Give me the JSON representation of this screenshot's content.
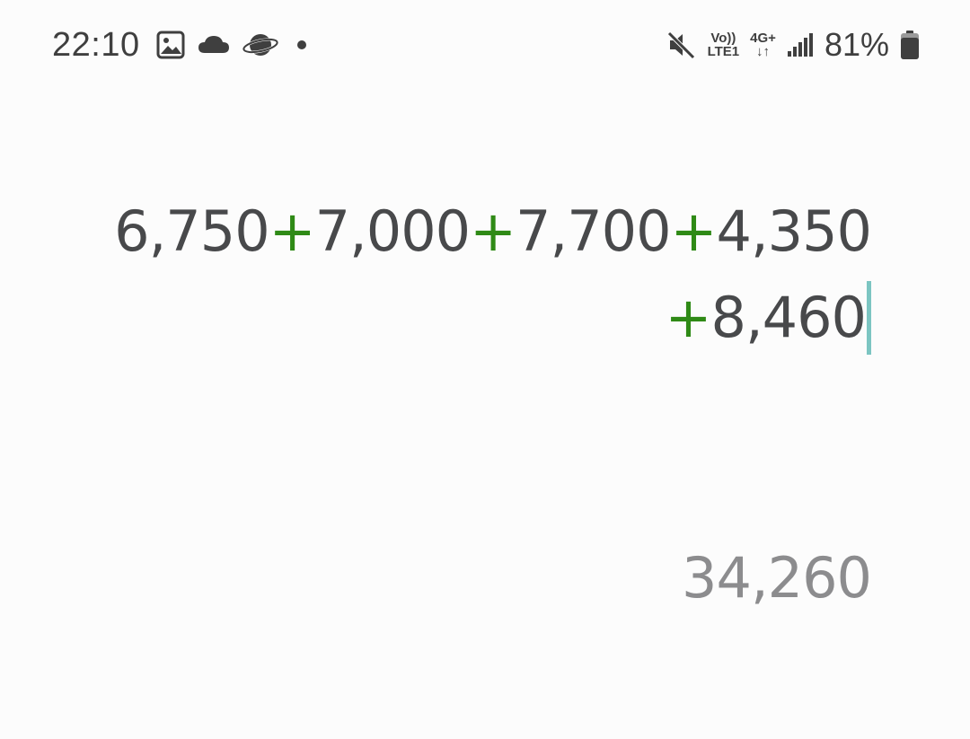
{
  "status_bar": {
    "time": "22:10",
    "left_icons": [
      "image-icon",
      "cloud-icon",
      "browser-planet-icon",
      "dot-icon"
    ],
    "volte_top": "Vo))",
    "volte_bottom": "LTE1",
    "network_type": "4G+",
    "data_arrows": "↓↑",
    "battery_percent": "81%",
    "right_icons": [
      "mute-icon",
      "signal-icon",
      "battery-icon"
    ]
  },
  "calculator": {
    "expression_line1": [
      {
        "text": "6,750",
        "kind": "num"
      },
      {
        "text": "+",
        "kind": "op"
      },
      {
        "text": "7,000",
        "kind": "num"
      },
      {
        "text": "+",
        "kind": "op"
      },
      {
        "text": "7,700",
        "kind": "num"
      },
      {
        "text": "+",
        "kind": "op"
      },
      {
        "text": "4,350",
        "kind": "num"
      }
    ],
    "expression_line2": [
      {
        "text": "+",
        "kind": "op"
      },
      {
        "text": "8,460",
        "kind": "num"
      }
    ],
    "result": "34,260"
  },
  "colors": {
    "operator": "#2f8a16",
    "number": "#48494b",
    "result": "#8c8c8e",
    "cursor": "#7cc5c2",
    "background": "#fcfcfc"
  }
}
